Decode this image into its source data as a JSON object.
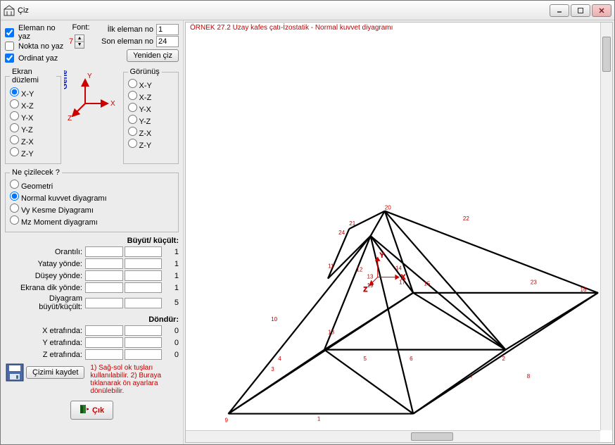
{
  "window": {
    "title": "Çiz"
  },
  "checks": {
    "eleman_no_yaz": "Eleman no yaz",
    "nokta_no_yaz": "Nokta no yaz",
    "ordinat_yaz": "Ordinat yaz"
  },
  "font": {
    "label": "Font:",
    "value": "7"
  },
  "eleman": {
    "ilk_label": "İlk eleman no",
    "ilk_value": "1",
    "son_label": "Son eleman no",
    "son_value": "24"
  },
  "redraw_button": "Yeniden çiz",
  "ekran_duzlemi": {
    "legend": "Ekran düzlemi",
    "options": [
      "X-Y",
      "X-Z",
      "Y-X",
      "Y-Z",
      "Z-X",
      "Z-Y"
    ]
  },
  "gorunus": {
    "legend": "Görünüş",
    "options": [
      "X-Y",
      "X-Z",
      "Y-X",
      "Y-Z",
      "Z-X",
      "Z-Y"
    ]
  },
  "axis_labels": {
    "x": "X",
    "y": "Y",
    "z": "Z",
    "genel": "Genel"
  },
  "ne_cizilecek": {
    "legend": "Ne çizilecek ?",
    "options": [
      "Geometri",
      "Normal kuvvet diyagramı",
      "Vy Kesme Diyagramı",
      "Mz Moment diyagramı"
    ]
  },
  "buyult_kucult": {
    "header": "Büyüt/ küçült:",
    "rows": [
      {
        "label": "Orantılı:",
        "val": "1"
      },
      {
        "label": "Yatay yönde:",
        "val": "1"
      },
      {
        "label": "Düşey yönde:",
        "val": "1"
      },
      {
        "label": "Ekrana dik yönde:",
        "val": "1"
      },
      {
        "label": "Diyagram büyüt/küçült:",
        "val": "5"
      }
    ]
  },
  "dondur": {
    "header": "Döndür:",
    "rows": [
      {
        "label": "X etrafında:",
        "val": "0"
      },
      {
        "label": "Y etrafında:",
        "val": "0"
      },
      {
        "label": "Z etrafında:",
        "val": "0"
      }
    ]
  },
  "save_button": "Çizimi kaydet",
  "hint_text": "1) Sağ-sol ok tuşları kullanılabilir.  2) Buraya tıklanarak ön ayarlara dönülebilir.",
  "exit_button": "Çık",
  "canvas": {
    "title": "ÖRNEK 27.2 Uzay kafes çatı-İzostatik - Normal kuvvet diyagramı",
    "labels": [
      "1",
      "2",
      "3",
      "4",
      "5",
      "6",
      "7",
      "8",
      "9",
      "10",
      "11",
      "12",
      "13",
      "14",
      "15",
      "16",
      "17",
      "18",
      "19",
      "20",
      "21",
      "22",
      "23",
      "24"
    ],
    "axis": {
      "x": "X",
      "y": "Y",
      "z": "Z"
    }
  }
}
